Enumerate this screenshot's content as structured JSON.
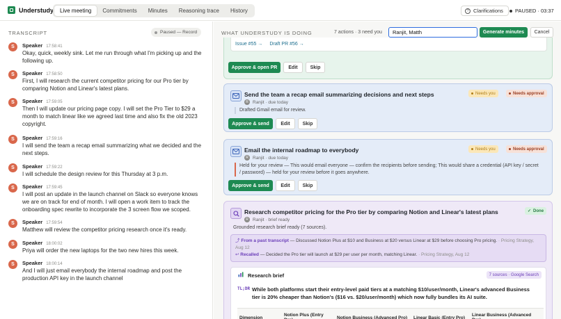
{
  "app": {
    "name": "Understudy"
  },
  "tabs": [
    {
      "label": "Live meeting",
      "active": true
    },
    {
      "label": "Commitments",
      "active": false
    },
    {
      "label": "Minutes",
      "active": false
    },
    {
      "label": "Reasoning trace",
      "active": false
    },
    {
      "label": "History",
      "active": false
    }
  ],
  "header": {
    "clarifications_label": "Clarifications",
    "session_status": "PAUSED · 03:37"
  },
  "transcript": {
    "heading": "TRANSCRIPT",
    "status": "Paused — Record",
    "utterances": [
      {
        "initial": "S",
        "speaker": "Speaker",
        "time": "17:58:41",
        "text": "Okay, quick, weekly sink. Let me run through what I'm picking up and the following up."
      },
      {
        "initial": "S",
        "speaker": "Speaker",
        "time": "17:58:50",
        "text": "First, I will research the current competitor pricing for our Pro tier by comparing Notion and Linear's latest plans."
      },
      {
        "initial": "S",
        "speaker": "Speaker",
        "time": "17:59:05",
        "text": "Then I will update our pricing page copy. I will set the Pro Tier to $29 a month to match linear like we agreed last time and also fix the old 2023 copyright."
      },
      {
        "initial": "S",
        "speaker": "Speaker",
        "time": "17:59:16",
        "text": "I will send the team a recap email summarizing what we decided and the next steps."
      },
      {
        "initial": "S",
        "speaker": "Speaker",
        "time": "17:59:22",
        "text": "I will schedule the design review for this Thursday at 3 p.m."
      },
      {
        "initial": "S",
        "speaker": "Speaker",
        "time": "17:59:45",
        "text": "I will post an update in the launch channel on Slack so everyone knows we are on track for end of month. I will open a work item to track the onboarding spec rewrite to incorporate the 3 screen flow we scoped."
      },
      {
        "initial": "S",
        "speaker": "Speaker",
        "time": "17:59:54",
        "text": "Matthew will review the competitor pricing research once it's ready."
      },
      {
        "initial": "S",
        "speaker": "Speaker",
        "time": "18:00:02",
        "text": "Priya will order the new laptops for the two new hires this week."
      },
      {
        "initial": "S",
        "speaker": "Speaker",
        "time": "18:00:14",
        "text": "And I will just email everybody the internal roadmap and post the production API key in the launch channel"
      }
    ]
  },
  "actions_panel": {
    "heading": "WHAT UNDERSTUDY IS DOING",
    "count_text": "7 actions · 3 need you",
    "attendee_input_value": "Ranjit, Matth",
    "generate_label": "Generate minutes",
    "cancel_label": "Cancel",
    "card_pr": {
      "links": [
        "Issue #55 →",
        "Draft PR #56 →"
      ],
      "primary_label": "Approve & open PR",
      "edit_label": "Edit",
      "skip_label": "Skip"
    },
    "card_recap": {
      "icon": "mail-icon",
      "title": "Send the team a recap email summarizing decisions and next steps",
      "meta": "Ranjit · due today",
      "avatar_initial": "R",
      "badge_needs_you": "Needs you",
      "badge_needs_approval": "Needs approval",
      "body": "Drafted Gmail email for review.",
      "primary_label": "Approve & send",
      "edit_label": "Edit",
      "skip_label": "Skip"
    },
    "card_roadmap": {
      "icon": "mail-icon",
      "title": "Email the internal roadmap to everybody",
      "meta": "Ranjit · due today",
      "avatar_initial": "R",
      "badge_needs_you": "Needs you",
      "badge_needs_approval": "Needs approval",
      "body": "Held for your review — This would email everyone — confirm the recipients before sending; This would share a credential (API key / secret / password) — held for your review before it goes anywhere.",
      "primary_label": "Approve & send",
      "edit_label": "Edit",
      "skip_label": "Skip"
    },
    "card_research": {
      "icon": "search-icon",
      "title": "Research competitor pricing for the Pro tier by comparing Notion and Linear's latest plans",
      "meta": "Ranjit · brief ready",
      "avatar_initial": "R",
      "badge_done": "Done",
      "body": "Grounded research brief ready (7 sources).",
      "past_link": "From a past transcript",
      "past_text": " — Discussed Notion Plus at $10 and Business at $20 versus Linear at $29 before choosing Pro pricing.",
      "past_source": " · Pricing Strategy, Aug 12",
      "recalled_link": "Recalled",
      "recalled_text": " — Decided the Pro tier will launch at $29 per user per month, matching Linear.",
      "recalled_source": " · Pricing Strategy, Aug 12",
      "brief_title": "Research brief",
      "brief_sources": "7 sources · Google Search",
      "tldr_tag": "TL;DR",
      "tldr_text": "While both platforms start their entry-level paid tiers at a matching $10/user/month, Linear's advanced Business tier is 20% cheaper than Notion's ($16 vs. $20/user/month) which now fully bundles its AI suite.",
      "table_headers": [
        "Dimension",
        "Notion Plus (Entry Pro)",
        "Notion Business (Advanced Pro)",
        "Linear Basic (Entry Pro)",
        "Linear Business (Advanced Pro)"
      ]
    }
  },
  "colors": {
    "accent_green": "#1e8a52",
    "avatar": "#d9674b",
    "input_focus": "#2d6cdf",
    "purple": "#6a3db8"
  }
}
